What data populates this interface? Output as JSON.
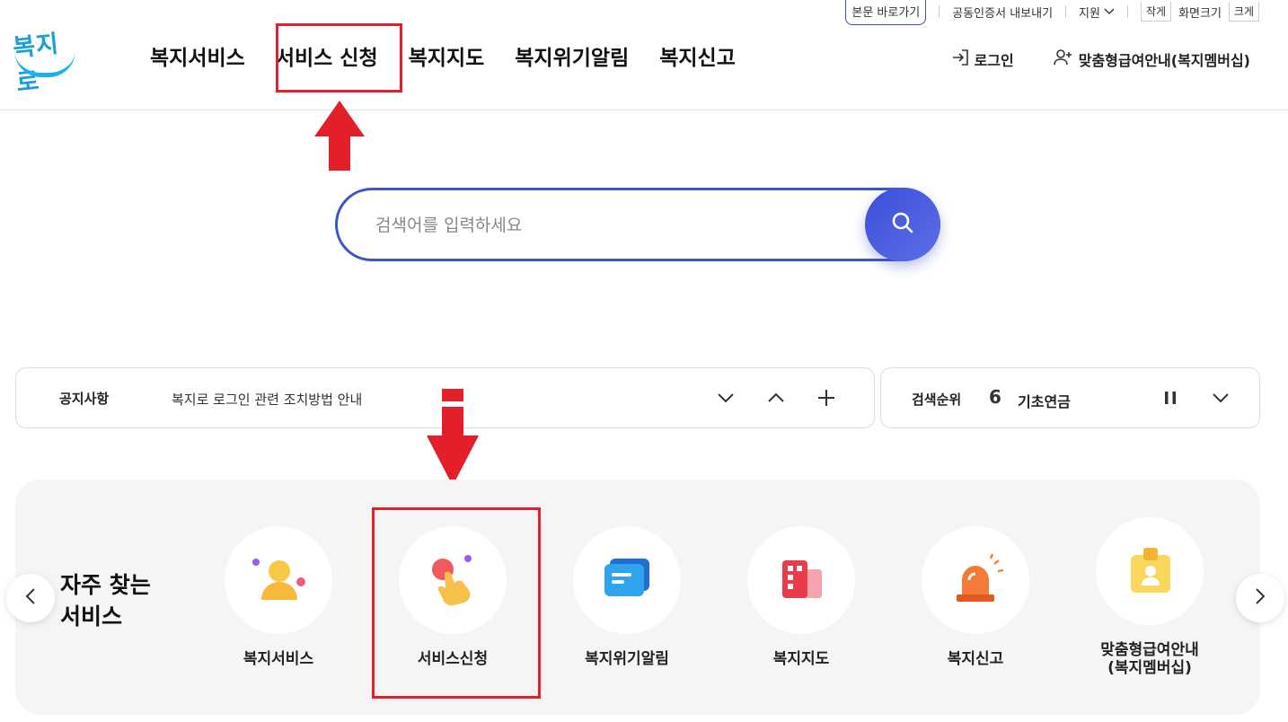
{
  "utility": {
    "skip_link": "본문 바로가기",
    "cert_export": "공동인증서 내보내기",
    "support": "지원",
    "zoom_small": "작게",
    "zoom_label": "화면크기",
    "zoom_large": "크게"
  },
  "logo": {
    "text": "복지로"
  },
  "gnb": {
    "items": [
      {
        "label": "복지서비스"
      },
      {
        "label": "서비스 신청"
      },
      {
        "label": "복지지도"
      },
      {
        "label": "복지위기알림"
      },
      {
        "label": "복지신고"
      }
    ]
  },
  "header_right": {
    "login": "로그인",
    "membership": "맞춤형급여안내(복지멤버십)"
  },
  "search": {
    "placeholder": "검색어를 입력하세요",
    "value": ""
  },
  "notice": {
    "title": "공지사항",
    "text": "복지로 로그인 관련 조치방법 안내"
  },
  "rank": {
    "title": "검색순위",
    "number": "6",
    "keyword": "기초연금"
  },
  "frequent": {
    "title_line1": "자주 찾는",
    "title_line2": "서비스",
    "items": [
      {
        "label": "복지서비스",
        "icon": "people-icon"
      },
      {
        "label": "서비스신청",
        "icon": "hand-tap-icon"
      },
      {
        "label": "복지위기알림",
        "icon": "message-icon"
      },
      {
        "label": "복지지도",
        "icon": "map-building-icon"
      },
      {
        "label": "복지신고",
        "icon": "siren-icon"
      },
      {
        "label_line1": "맞춤형급여안내",
        "label_line2": "(복지멤버십)",
        "icon": "id-card-icon"
      }
    ]
  },
  "colors": {
    "brand": "#1a9fd6",
    "search_border": "#3e55c4",
    "highlight": "#e3202a"
  }
}
